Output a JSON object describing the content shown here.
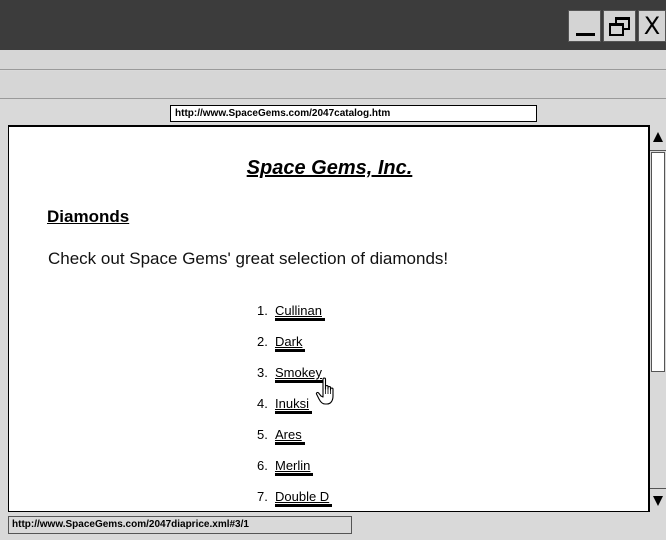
{
  "window": {
    "close_label": "X",
    "minimize_icon": "minimize-icon",
    "restore_icon": "restore-icon"
  },
  "address_bar": {
    "url": "http://www.SpaceGems.com/2047catalog.htm"
  },
  "page": {
    "site_title": "Space Gems, Inc.",
    "section_heading": "Diamonds",
    "intro_text": "Check out Space Gems' great selection of diamonds!",
    "diamonds": [
      {
        "number": "1.",
        "name": "Cullinan"
      },
      {
        "number": "2.",
        "name": "Dark"
      },
      {
        "number": "3.",
        "name": "Smokey"
      },
      {
        "number": "4.",
        "name": "Inuksi"
      },
      {
        "number": "5.",
        "name": "Ares"
      },
      {
        "number": "6.",
        "name": "Merlin"
      },
      {
        "number": "7.",
        "name": "Double D"
      }
    ]
  },
  "cursor": {
    "icon": "hand-pointer-icon"
  },
  "status_bar": {
    "text": "http://www.SpaceGems.com/2047diaprice.xml#3/1"
  },
  "colors": {
    "titlebar": "#3c3c3c",
    "chrome": "#d9d9d9",
    "content_background": "#ffffff",
    "text": "#000000"
  }
}
